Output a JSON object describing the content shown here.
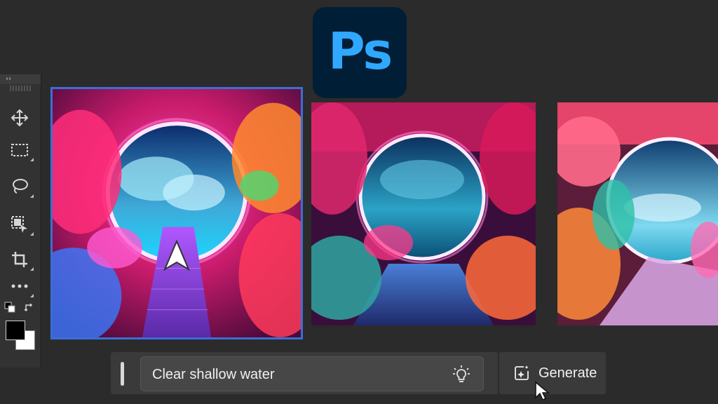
{
  "app": {
    "logo_text": "Ps",
    "logo_bg": "#001e36",
    "logo_fg": "#31a8ff"
  },
  "toolbar": {
    "collapse_label": "››",
    "tools": [
      {
        "name": "move-tool",
        "icon": "move-icon"
      },
      {
        "name": "marquee-tool",
        "icon": "rectangular-marquee-icon"
      },
      {
        "name": "lasso-tool",
        "icon": "lasso-icon"
      },
      {
        "name": "object-selection-tool",
        "icon": "object-selection-icon"
      },
      {
        "name": "crop-tool",
        "icon": "crop-icon"
      },
      {
        "name": "more-tools",
        "icon": "ellipsis-icon"
      }
    ],
    "foreground_color": "#000000",
    "background_color": "#ffffff"
  },
  "variations": [
    {
      "name": "variation-1",
      "selected": true
    },
    {
      "name": "variation-2",
      "selected": false
    },
    {
      "name": "variation-3",
      "selected": false
    }
  ],
  "prompt_bar": {
    "value": "Clear shallow water",
    "suggestion_icon": "lightbulb-icon"
  },
  "generate_button": {
    "label": "Generate",
    "icon": "generate-sparkle-icon"
  },
  "accent_color": "#3d6dd6"
}
